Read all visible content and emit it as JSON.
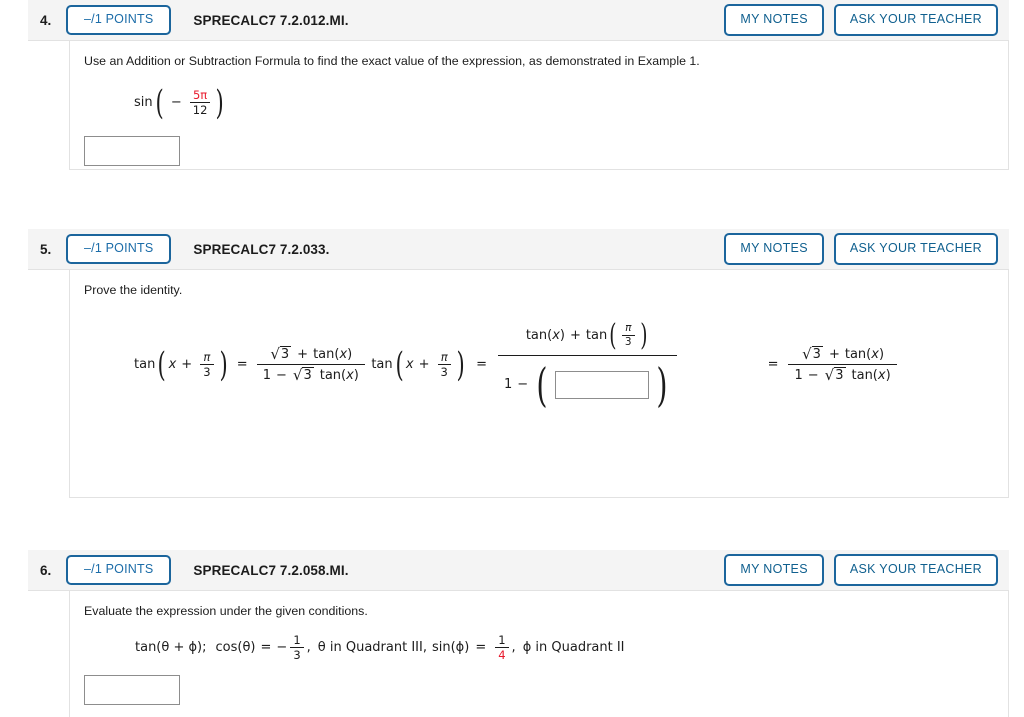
{
  "theme": {
    "accent_blue": "#1b659c",
    "link_blue": "#10608f",
    "header_bg": "#f4f4f4",
    "border_gray": "#e2e2e2",
    "red": "#e8192c",
    "text": "#1c1c1c"
  },
  "common": {
    "points_label": "–/1 POINTS",
    "my_notes_label": "MY NOTES",
    "ask_teacher_label": "ASK YOUR TEACHER"
  },
  "questions": [
    {
      "number": "4.",
      "points": "–/1 POINTS",
      "code": "SPRECALC7 7.2.012.MI.",
      "prompt": "Use an Addition or Subtraction Formula to find the exact value of the expression, as demonstrated in Example 1.",
      "expression": {
        "function": "sin",
        "sign": "−",
        "numerator": "5π",
        "numerator_color": "#e8192c",
        "denominator": "12"
      },
      "answer_value": ""
    },
    {
      "number": "5.",
      "points": "–/1 POINTS",
      "code": "SPRECALC7 7.2.033.",
      "prompt": "Prove the identity.",
      "identity": {
        "lhs_fn": "tan",
        "lhs_var": "x",
        "lhs_plus": "+",
        "lhs_num": "π",
        "lhs_den": "3",
        "equals": "=",
        "rhs_num_radicand": "3",
        "rhs_num_plus": "+",
        "rhs_num_tan": "tan(x)",
        "rhs_den_one": "1",
        "rhs_den_minus": "−",
        "rhs_den_radicand": "3",
        "rhs_den_tan": "tan(x)"
      },
      "work_line": {
        "num_tan_x": "tan(x)",
        "num_plus": "+",
        "num_tan_fn": "tan",
        "num_frac_num": "π",
        "num_frac_den": "3",
        "den_one": "1",
        "den_minus": "−",
        "den_open_paren": "(",
        "den_close_paren": ")"
      },
      "final_line": {
        "equals": "=",
        "num_radicand": "3",
        "num_plus": "+",
        "num_tan": "tan(x)",
        "den_one": "1",
        "den_minus": "−",
        "den_radicand": "3",
        "den_tan": "tan(x)"
      },
      "answer_value": ""
    },
    {
      "number": "6.",
      "points": "–/1 POINTS",
      "code": "SPRECALC7 7.2.058.MI.",
      "prompt": "Evaluate the expression under the given conditions.",
      "conditions": {
        "target": "tan(θ + ϕ);",
        "cos_label": "cos(θ)",
        "cos_equals": "=",
        "cos_sign": "−",
        "cos_num": "1",
        "cos_den": "3",
        "cos_den_color": "#1c1c1c",
        "theta_quadrant": "θ in Quadrant III,",
        "sin_label": "sin(ϕ)",
        "sin_equals": "=",
        "sin_num": "1",
        "sin_den": "4",
        "sin_den_color": "#e8192c",
        "phi_quadrant": "ϕ in Quadrant II"
      },
      "answer_value": ""
    }
  ]
}
